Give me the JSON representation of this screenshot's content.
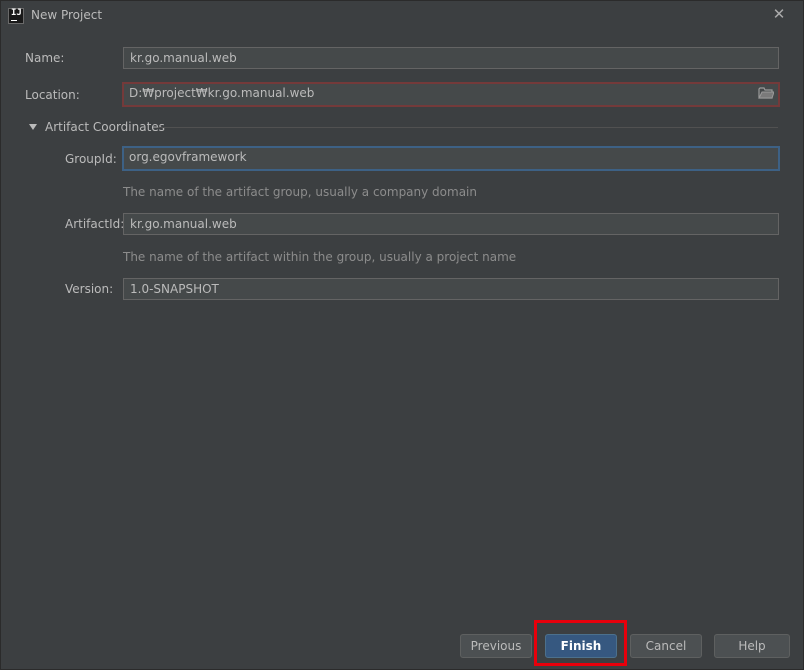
{
  "window": {
    "title": "New Project",
    "app_icon_text": "IJ",
    "colors": {
      "background": "#3c3f41",
      "field_bg": "#45494a",
      "accent": "#365880",
      "error_border": "#743a3a",
      "focus_border": "#3d6185",
      "annotation": "#e8000b"
    }
  },
  "form": {
    "name_label": "Name:",
    "name_value": "kr.go.manual.web",
    "location_label": "Location:",
    "location_value": "D:₩project₩kr.go.manual.web",
    "location_browse_icon": "folder-icon"
  },
  "artifact": {
    "section_title": "Artifact Coordinates",
    "expanded": true,
    "groupid_label": "GroupId:",
    "groupid_value": "org.egovframework",
    "groupid_hint": "The name of the artifact group, usually a company domain",
    "artifactid_label": "ArtifactId:",
    "artifactid_value": "kr.go.manual.web",
    "artifactid_hint": "The name of the artifact within the group, usually a project name",
    "version_label": "Version:",
    "version_value": "1.0-SNAPSHOT"
  },
  "buttons": {
    "previous": "Previous",
    "finish": "Finish",
    "cancel": "Cancel",
    "help": "Help"
  }
}
